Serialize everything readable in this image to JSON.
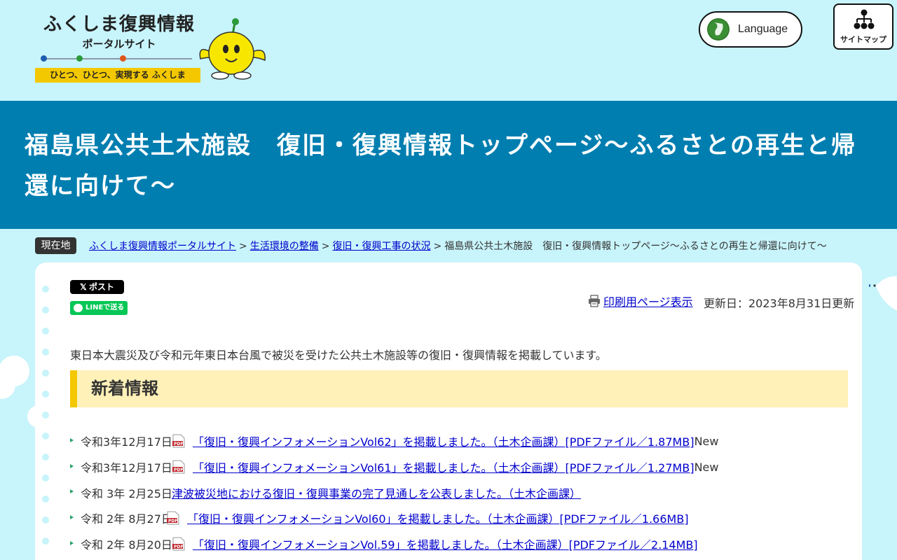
{
  "header": {
    "logo_title": "ふくしま復興情報",
    "logo_subtitle": "ポータルサイト",
    "logo_tagline": "ひとつ、ひとつ、実現する ふくしま",
    "language_label": "Language",
    "sitemap_label": "サイトマップ"
  },
  "page_title": "福島県公共土木施設　復旧・復興情報トップページ～ふるさとの再生と帰還に向けて～",
  "breadcrumb": {
    "label": "現在地",
    "items": [
      "ふくしま復興情報ポータルサイト",
      "生活環境の整備",
      "復旧・復興工事の状況"
    ],
    "current": "福島県公共土木施設　復旧・復興情報トップページ～ふるさとの再生と帰還に向けて～",
    "separator": ">"
  },
  "share": {
    "x_label": "𝕏 ポスト",
    "line_label": "LINEで送る"
  },
  "print_label": "印刷用ページ表示",
  "updated": "更新日：2023年8月31日更新",
  "intro": "東日本大震災及び令和元年東日本台風で被災を受けた公共土木施設等の復旧・復興情報を掲載しています。",
  "section_title": "新着情報",
  "news": [
    {
      "date": "令和3年12月17日",
      "title": "「復旧・復興インフォメーションVol62」を掲載しました。（土木企画課）",
      "file": "[PDFファイル／1.87MB]",
      "badge": "New"
    },
    {
      "date": "令和3年12月17日",
      "title": "「復旧・復興インフォメーションVol61」を掲載しました。（土木企画課）",
      "file": "[PDFファイル／1.27MB]",
      "badge": "New"
    },
    {
      "date": "令和 3年 2月25日",
      "title": "津波被災地における復旧・復興事業の完了見通しを公表しました。（土木企画課）",
      "file": "",
      "badge": ""
    },
    {
      "date": "令和 2年 8月27日",
      "title": "「復旧・復興インフォメーションVol60」を掲載しました。（土木企画課）",
      "file": "[PDFファイル／1.66MB]",
      "badge": ""
    },
    {
      "date": "令和 2年 8月20日",
      "title": "「復旧・復興インフォメーションVol.59」を掲載しました。（土木企画課）",
      "file": "[PDFファイル／2.14MB]",
      "badge": ""
    }
  ],
  "colors": {
    "sky": "#c8f4fb",
    "title_band": "#007eb0",
    "accent_yellow": "#f4c800",
    "section_bg": "#fff1b8",
    "link": "#0000cc"
  }
}
